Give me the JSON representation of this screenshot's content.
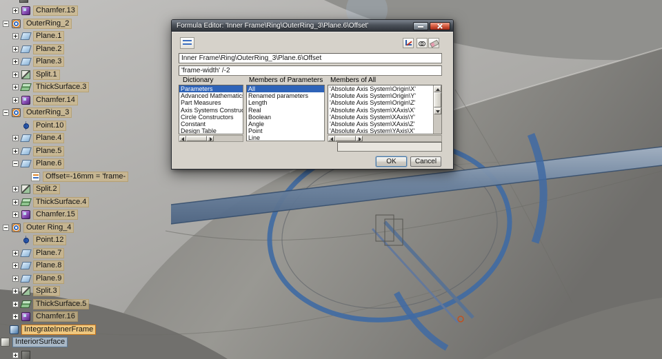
{
  "viewport": {
    "description": "3D CAD viewport with gray swept surfaces and blue highlighted inner-frame rings"
  },
  "tree": {
    "items": [
      {
        "label": "",
        "icon": "feature-icon",
        "pad": 28,
        "expander": "none"
      },
      {
        "label": "Chamfer.13",
        "icon": "chamfer-icon",
        "pad": 18,
        "expander": "plus"
      },
      {
        "label": "OuterRing_2",
        "icon": "ring-icon",
        "pad": 4,
        "expander": "minus"
      },
      {
        "label": "Plane.1",
        "icon": "plane-icon",
        "pad": 18,
        "expander": "plus"
      },
      {
        "label": "Plane.2",
        "icon": "plane-icon",
        "pad": 18,
        "expander": "plus"
      },
      {
        "label": "Plane.3",
        "icon": "plane-icon",
        "pad": 18,
        "expander": "plus"
      },
      {
        "label": "Split.1",
        "icon": "split-icon",
        "pad": 18,
        "expander": "plus"
      },
      {
        "label": "ThickSurface.3",
        "icon": "thicksurface-icon",
        "pad": 18,
        "expander": "plus"
      },
      {
        "label": "Chamfer.14",
        "icon": "chamfer-icon",
        "pad": 18,
        "expander": "plus"
      },
      {
        "label": "OuterRing_3",
        "icon": "ring-icon",
        "pad": 4,
        "expander": "minus"
      },
      {
        "label": "Point.10",
        "icon": "point-icon",
        "pad": 31,
        "expander": "none"
      },
      {
        "label": "Plane.4",
        "icon": "plane-icon",
        "pad": 18,
        "expander": "plus"
      },
      {
        "label": "Plane.5",
        "icon": "plane-icon",
        "pad": 18,
        "expander": "plus"
      },
      {
        "label": "Plane.6",
        "icon": "plane-icon",
        "pad": 18,
        "expander": "minus"
      },
      {
        "label": "Offset=-16mm = 'frame-",
        "icon": "formula-icon",
        "pad": 45,
        "expander": "none"
      },
      {
        "label": "Split.2",
        "icon": "split-icon",
        "pad": 18,
        "expander": "plus"
      },
      {
        "label": "ThickSurface.4",
        "icon": "thicksurface-icon",
        "pad": 18,
        "expander": "plus"
      },
      {
        "label": "Chamfer.15",
        "icon": "chamfer-icon",
        "pad": 18,
        "expander": "plus"
      },
      {
        "label": "Outer Ring_4",
        "icon": "ring-icon",
        "pad": 4,
        "expander": "minus"
      },
      {
        "label": "Point.12",
        "icon": "point-icon",
        "pad": 31,
        "expander": "none"
      },
      {
        "label": "Plane.7",
        "icon": "plane-icon",
        "pad": 18,
        "expander": "plus"
      },
      {
        "label": "Plane.8",
        "icon": "plane-icon",
        "pad": 18,
        "expander": "plus"
      },
      {
        "label": "Plane.9",
        "icon": "plane-icon",
        "pad": 18,
        "expander": "plus"
      },
      {
        "label": "Split.3",
        "icon": "split-icon",
        "pad": 18,
        "expander": "plus"
      },
      {
        "label": "ThickSurface.5",
        "icon": "thicksurface-icon",
        "pad": 18,
        "expander": "plus"
      },
      {
        "label": "Chamfer.16",
        "icon": "chamfer-icon",
        "pad": 18,
        "expander": "plus"
      },
      {
        "label": "IntegrateInnerFrame",
        "icon": "integrate-icon",
        "pad": 14,
        "expander": "none",
        "highlight": "orange"
      },
      {
        "label": "InteriorSurface",
        "icon": "surface-icon",
        "pad": 1,
        "expander": "none",
        "highlight": "blue"
      },
      {
        "label": "",
        "icon": "feature-icon",
        "pad": 18,
        "expander": "plus"
      }
    ]
  },
  "dialog": {
    "title": "Formula Editor: 'Inner Frame\\Ring\\OuterRing_3\\Plane.6\\Offset'",
    "path_value": "Inner Frame\\Ring\\OuterRing_3\\Plane.6\\Offset",
    "formula_value": "'frame-width' /-2",
    "toolbar_icons": [
      "formula-structure-icon",
      "axes-graph-icon",
      "spectacles-icon",
      "eraser-icon"
    ],
    "columns": [
      {
        "header": "Dictionary",
        "items": [
          "Parameters",
          "Advanced Mathematics F",
          "Part Measures",
          "Axis Systems Constructor",
          "Circle Constructors",
          "Constant",
          "Design Table"
        ],
        "selected_index": 0
      },
      {
        "header": "Members of Parameters",
        "items": [
          "All",
          "Renamed parameters",
          "Length",
          "Real",
          "Boolean",
          "Angle",
          "Point",
          "Line"
        ],
        "selected_index": 0
      },
      {
        "header": "Members of All",
        "items": [
          "'Absolute Axis System\\Origin\\X'",
          "'Absolute Axis System\\Origin\\Y'",
          "'Absolute Axis System\\Origin\\Z'",
          "'Absolute Axis System\\XAxis\\X'",
          "'Absolute Axis System\\XAxis\\Y'",
          "'Absolute Axis System\\XAxis\\Z'",
          "'Absolute Axis System\\YAxis\\X'"
        ],
        "selected_index": -1
      }
    ],
    "value_field": "",
    "ok_label": "OK",
    "cancel_label": "Cancel",
    "accent_colors": {
      "selection_blue": "#2e63b8",
      "highlight_orange": "#c8761c",
      "ring_blue": "#3f6aa3"
    }
  }
}
